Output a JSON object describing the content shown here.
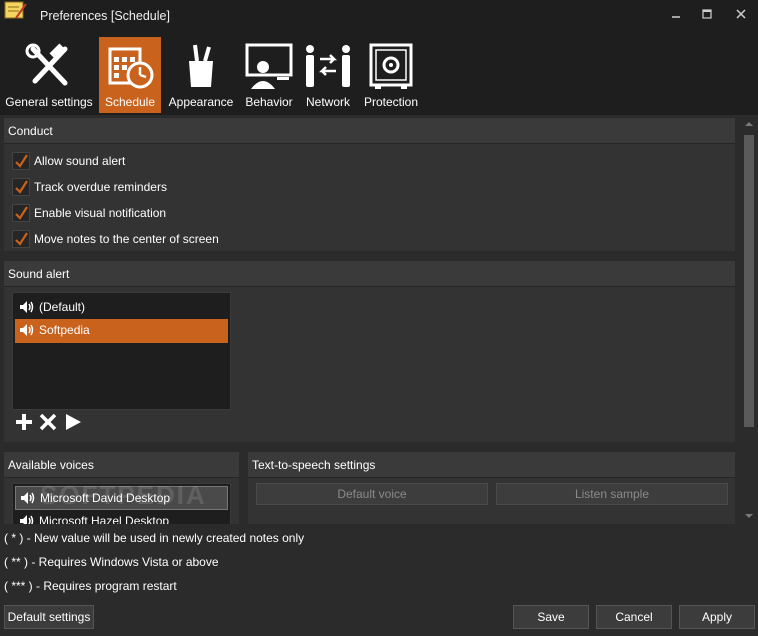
{
  "window": {
    "title": "Preferences [Schedule]",
    "icons": {
      "app": "sticky-note-icon",
      "minimize": "minimize-icon",
      "maximize": "maximize-icon",
      "close": "close-icon"
    }
  },
  "tabs": [
    {
      "label": "General settings",
      "icon": "tools-icon",
      "active": false
    },
    {
      "label": "Schedule",
      "icon": "calendar-clock-icon",
      "active": true
    },
    {
      "label": "Appearance",
      "icon": "brushes-icon",
      "active": false
    },
    {
      "label": "Behavior",
      "icon": "monitor-user-icon",
      "active": false
    },
    {
      "label": "Network",
      "icon": "network-users-icon",
      "active": false
    },
    {
      "label": "Protection",
      "icon": "safe-icon",
      "active": false
    }
  ],
  "conduct": {
    "title": "Conduct",
    "options": [
      {
        "label": "Allow sound alert",
        "checked": true
      },
      {
        "label": "Track overdue reminders",
        "checked": true
      },
      {
        "label": "Enable visual notification",
        "checked": true
      },
      {
        "label": "Move notes to the center of screen",
        "checked": true
      }
    ]
  },
  "sound_alert": {
    "title": "Sound alert",
    "items": [
      {
        "label": "(Default)",
        "selected": false
      },
      {
        "label": "Softpedia",
        "selected": true
      }
    ],
    "actions": [
      "add-icon",
      "remove-icon",
      "play-icon"
    ]
  },
  "voices": {
    "title": "Available voices",
    "items": [
      {
        "label": "Microsoft David Desktop",
        "selected": true
      },
      {
        "label": "Microsoft Hazel Desktop",
        "selected": false
      }
    ]
  },
  "tts": {
    "title": "Text-to-speech settings",
    "default_voice_label": "Default voice",
    "listen_sample_label": "Listen sample"
  },
  "notes": [
    "( * ) - New value will be used in newly created notes only",
    "( ** ) - Requires Windows Vista or above",
    "( *** ) - Requires program restart"
  ],
  "footer": {
    "default_settings": "Default settings",
    "save": "Save",
    "cancel": "Cancel",
    "apply": "Apply"
  },
  "watermark": "SOFTPEDIA",
  "colors": {
    "accent": "#c8621c",
    "background": "#2b2b2b",
    "panel": "#333333",
    "titlebar": "#1e1e1e"
  }
}
